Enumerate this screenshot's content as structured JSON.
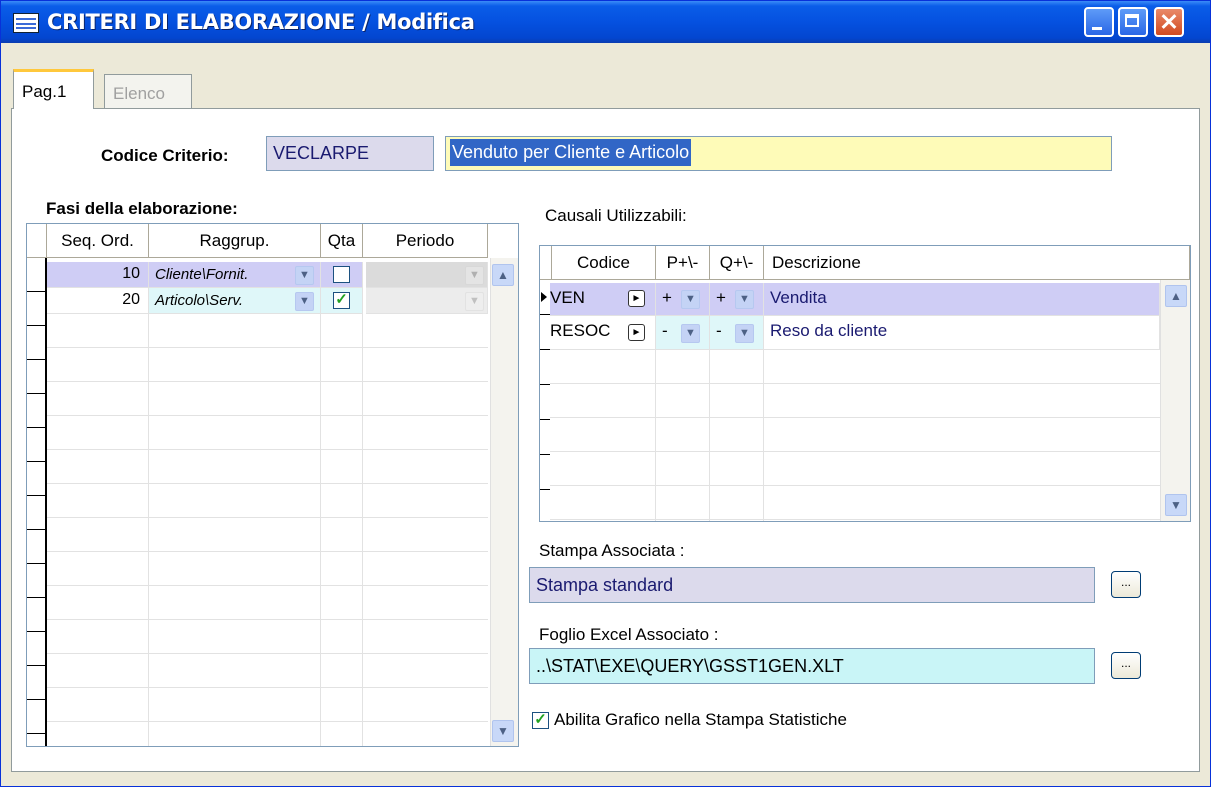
{
  "window": {
    "title": "CRITERI DI ELABORAZIONE / Modifica"
  },
  "tabs": [
    {
      "label": "Pag.1",
      "active": true
    },
    {
      "label": "Elenco",
      "active": false
    }
  ],
  "criterio": {
    "label": "Codice Criterio:",
    "code": "VECLARPE",
    "description": "Venduto per Cliente e Articolo"
  },
  "fasi": {
    "title": "Fasi della elaborazione:",
    "columns": [
      "Seq. Ord.",
      "Raggrup.",
      "Qta",
      "Periodo"
    ],
    "rows": [
      {
        "seq": "10",
        "raggrup": "Cliente\\Fornit.",
        "qta": false
      },
      {
        "seq": "20",
        "raggrup": "Articolo\\Serv.",
        "qta": true
      }
    ]
  },
  "causali": {
    "title": "Causali Utilizzabili:",
    "columns": [
      "Codice",
      "P+\\-",
      "Q+\\-",
      "Descrizione"
    ],
    "rows": [
      {
        "codice": "VEN",
        "p": "+",
        "q": "+",
        "descrizione": "Vendita"
      },
      {
        "codice": "RESOC",
        "p": "-",
        "q": "-",
        "descrizione": "Reso da cliente"
      }
    ]
  },
  "stampa": {
    "label": "Stampa  Associata :",
    "value": "Stampa standard",
    "button": "..."
  },
  "excel": {
    "label": "Foglio Excel Associato :",
    "value": "..\\STAT\\EXE\\QUERY\\GSST1GEN.XLT",
    "button": "..."
  },
  "grafico": {
    "label": "Abilita Grafico nella Stampa Statistiche",
    "checked": true
  },
  "colors": {
    "titlebar": "#0551e0",
    "selected_row": "#cfcdf5",
    "readonly_field": "#dcdaec",
    "desc_field": "#fefbb8",
    "excel_field": "#c9f5f7"
  }
}
